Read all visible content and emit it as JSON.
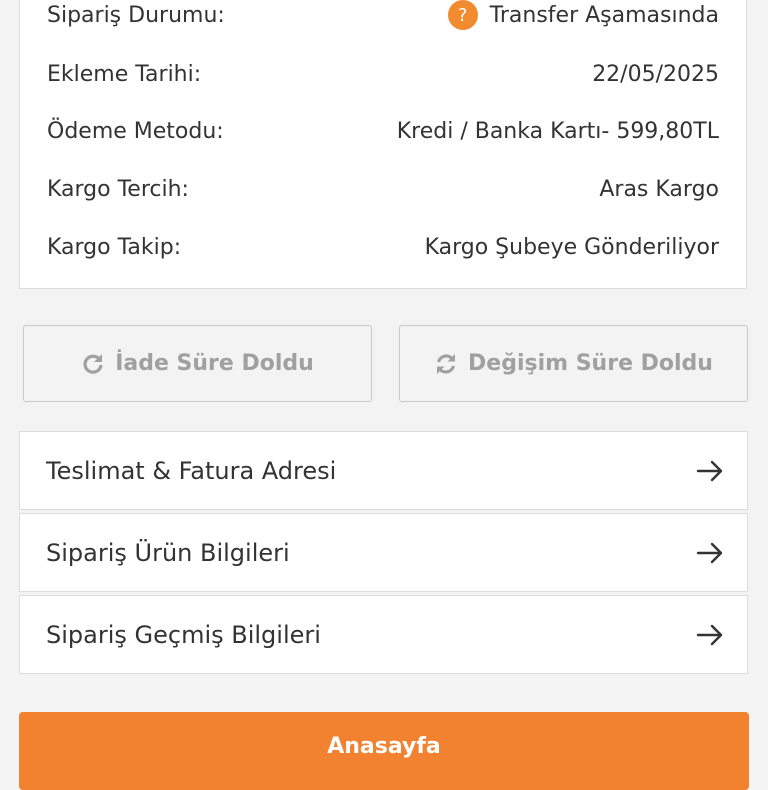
{
  "order_info": {
    "rows": [
      {
        "label": "Sipariş Durumu:",
        "value": "Transfer Aşamasında"
      },
      {
        "label": "Ekleme Tarihi:",
        "value": "22/05/2025"
      },
      {
        "label": "Ödeme Metodu:",
        "value": "Kredi / Banka Kartı- 599,80TL"
      },
      {
        "label": "Kargo Tercih:",
        "value": "Aras Kargo"
      },
      {
        "label": "Kargo Takip:",
        "value": "Kargo Şubeye Gönderiliyor"
      }
    ],
    "status_icon": "question-icon",
    "status_glyph": "?",
    "status_color": "#f28a30"
  },
  "actions": {
    "return_label": "İade Süre Doldu",
    "exchange_label": "Değişim Süre Doldu"
  },
  "links": [
    {
      "label": "Teslimat & Fatura Adresi"
    },
    {
      "label": "Sipariş Ürün Bilgileri"
    },
    {
      "label": "Sipariş Geçmiş Bilgileri"
    }
  ],
  "home_button": {
    "label": "Anasayfa",
    "color": "#f28230"
  }
}
